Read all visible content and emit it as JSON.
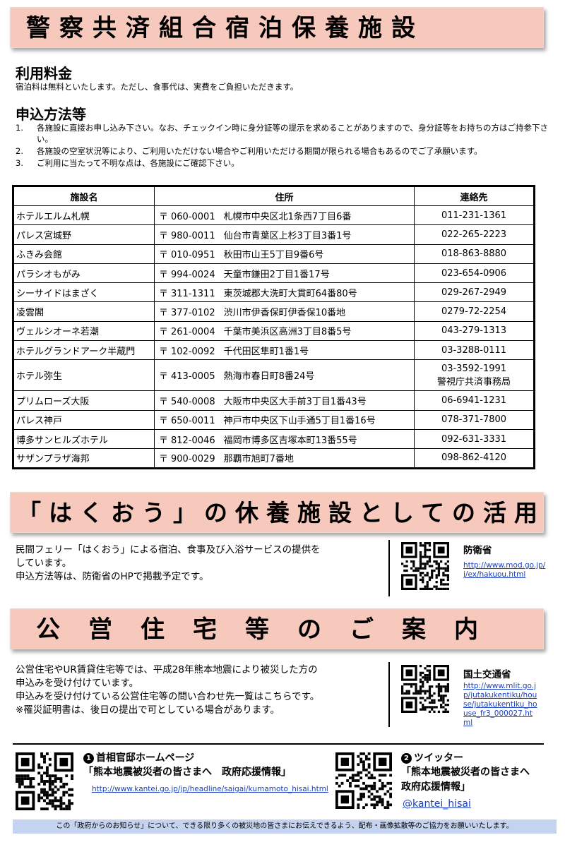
{
  "title_banner": "警察共済組合宿泊保養施設",
  "fee": {
    "heading": "利用料金",
    "text": "宿泊料は無料といたします。ただし、食事代は、実費をご負担いただきます。"
  },
  "apply": {
    "heading": "申込方法等",
    "items": [
      {
        "num": "1.",
        "text": "各施設に直接お申し込み下さい。なお、チェックイン時に身分証等の提示を求めることがありますので、身分証等をお持ちの方はご持参下さい。"
      },
      {
        "num": "2.",
        "text": "各施設の空室状況等により、ご利用いただけない場合やご利用いただける期間が限られる場合もあるのでご了承願います。"
      },
      {
        "num": "3.",
        "text": "ご利用に当たって不明な点は、各施設にご確認下さい。"
      }
    ]
  },
  "table": {
    "headers": [
      "施設名",
      "住所",
      "連絡先"
    ],
    "zip_mark": "〒",
    "rows": [
      {
        "name": "ホテルエルム札幌",
        "zip": "060-0001",
        "address": "札幌市中央区北1条西7丁目6番",
        "tel": "011-231-1361"
      },
      {
        "name": "パレス宮城野",
        "zip": "980-0011",
        "address": "仙台市青葉区上杉3丁目3番1号",
        "tel": "022-265-2223"
      },
      {
        "name": "ふきみ会館",
        "zip": "010-0951",
        "address": "秋田市山王5丁目9番6号",
        "tel": "018-863-8880"
      },
      {
        "name": "パラシオもがみ",
        "zip": "994-0024",
        "address": "天童市鎌田2丁目1番17号",
        "tel": "023-654-0906"
      },
      {
        "name": "シーサイドはまざく",
        "zip": "311-1311",
        "address": "東茨城郡大洗町大貫町64番80号",
        "tel": "029-267-2949"
      },
      {
        "name": "凌雲閣",
        "zip": "377-0102",
        "address": "渋川市伊香保町伊香保10番地",
        "tel": "0279-72-2254"
      },
      {
        "name": "ヴェルシオーネ若潮",
        "zip": "261-0004",
        "address": "千葉市美浜区高洲3丁目8番5号",
        "tel": "043-279-1313"
      },
      {
        "name": "ホテルグランドアーク半蔵門",
        "zip": "102-0092",
        "address": "千代田区隼町1番1号",
        "tel": "03-3288-0111"
      },
      {
        "name": "ホテル弥生",
        "zip": "413-0005",
        "address": "熱海市春日町8番24号",
        "tel": "03-3592-1991",
        "tel_note": "警視庁共済事務局"
      },
      {
        "name": "プリムローズ大阪",
        "zip": "540-0008",
        "address": "大阪市中央区大手前3丁目1番43号",
        "tel": "06-6941-1231"
      },
      {
        "name": "パレス神戸",
        "zip": "650-0011",
        "address": "神戸市中央区下山手通5丁目1番16号",
        "tel": "078-371-7800"
      },
      {
        "name": "博多サンヒルズホテル",
        "zip": "812-0046",
        "address": "福岡市博多区吉塚本町13番55号",
        "tel": "092-631-3331"
      },
      {
        "name": "サザンプラザ海邦",
        "zip": "900-0029",
        "address": "那覇市旭町7番地",
        "tel": "098-862-4120"
      }
    ]
  },
  "hakuou": {
    "banner": "「はくおう」の休養施設としての活用",
    "lines": [
      "民間フェリー「はくおう」による宿泊、食事及び入浴サービスの提供を",
      "しています。",
      "申込方法等は、防衛省のHPで掲載予定です。"
    ],
    "org": "防衛省",
    "url": "http://www.mod.go.jp/j/ex/hakuou.html"
  },
  "housing": {
    "banner": "公営住宅等のご案内",
    "lines": [
      "公営住宅やUR賃貸住宅等では、平成28年熊本地震により被災した方の",
      "申込みを受け付けています。",
      "申込みを受け付けている公営住宅等の問い合わせ先一覧はこちらです。",
      "※罹災証明書は、後日の提出で可としている場合があります。"
    ],
    "org": "国土交通省",
    "url": "http://www.mlit.go.jp/jutakukentiku/house/jutakukentiku_house_fr3_000027.html"
  },
  "links": {
    "kantei": {
      "marker": "1",
      "title": "首相官邸ホームページ",
      "subtitle": "「熊本地震被災者の皆さまへ　政府応援情報」",
      "url": "http://www.kantei.go.jp/jp/headline/saigai/kumamoto_hisai.html"
    },
    "twitter": {
      "marker": "2",
      "title": "ツイッター",
      "subtitle_line1": "「熊本地震被災者の皆さまへ",
      "subtitle_line2": "政府応援情報」",
      "handle": "@kantei_hisai"
    }
  },
  "footer": "この「政府からのお知らせ」について、できる限り多くの被災地の皆さまにお伝えできるよう、配布・画像拡散等のご協力をお願いいたします。",
  "colors": {
    "banner_bg": "#f7c9bd",
    "footer_bg": "#c4d3ef",
    "link": "#1a3fbf"
  }
}
